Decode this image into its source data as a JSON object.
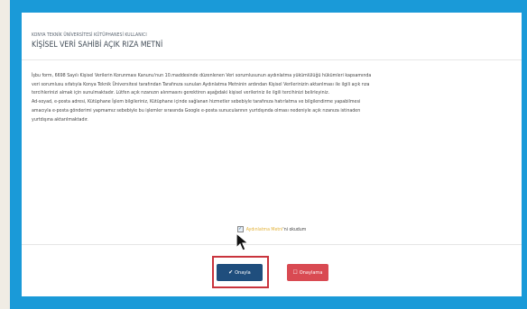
{
  "form": {
    "subtitle": "KONYA TEKNİK ÜNİVERSİTESİ KÜTÜPHANESİ KULLANICI",
    "title": "KİŞİSEL VERİ SAHİBİ AÇIK RIZA METNİ",
    "paragraph_lines": [
      "İşbu form, 6698 Sayılı Kişisel Verilerin Korunması Kanunu'nun 10.maddesinde düzenlenen Veri sorumlusunun aydınlatma yükümlülüğü hükümleri kapsamında",
      "veri sorumlusu sıfatıyla Konya Teknik Üniversitesi tarafından Tarafınıza sunulan Aydınlatma Metninin ardından Kişisel Verilerinizin aktarılması ile ilgili açık rıza",
      "tercihlerinizi almak için sunulmaktadır. Lütfen açık rızanızın alınmasını gerektiren aşağıdaki kişisel verileriniz ile ilgili tercihinizi belirleyiniz.",
      "Ad-soyad, e-posta adresi, Kütüphane İşlem bilgileriniz, Kütüphane içinde sağlanan hizmetler sebebiyle tarafınıza hatırlatma ve bilgilendirme yapabilmesi",
      "amacıyla e-posta gönderimi yapmamız sebebiyle bu işlemler sırasında Google e-posta sunucularının yurtdışında olması nedeniyle açık rızanıza istinaden",
      "yurtdışına aktarılmaktadır."
    ]
  },
  "consent": {
    "checked": true,
    "link_text": "Aydınlatma Metni",
    "suffix_text": "'ni okudum"
  },
  "buttons": {
    "approve_icon": "✔",
    "approve_label": "Onayla",
    "reject_icon": "☐",
    "reject_label": "Onaylama"
  },
  "colors": {
    "background": "#1a9ad8",
    "approve": "#1f4e7d",
    "reject": "#d94a52",
    "highlight": "#c9343d",
    "link": "#e2b23a"
  }
}
